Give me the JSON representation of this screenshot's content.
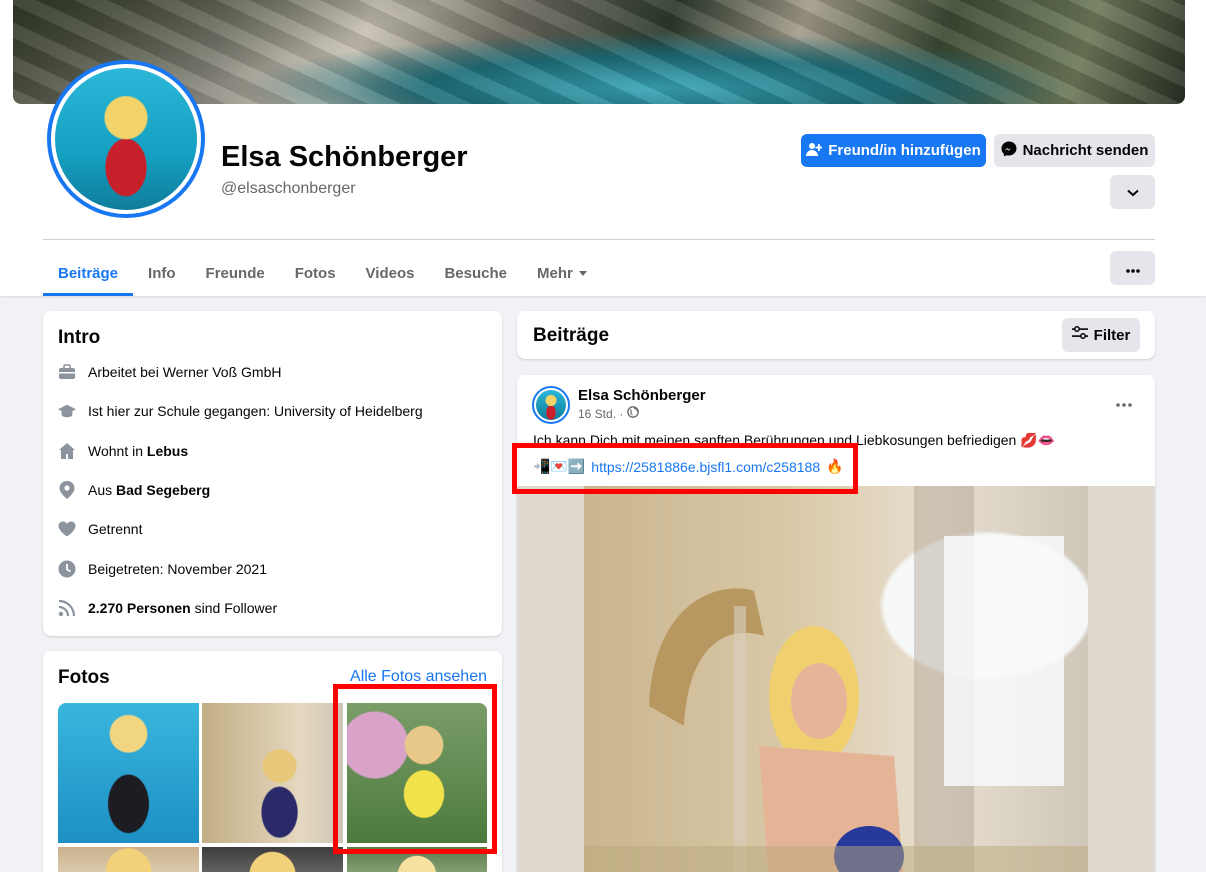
{
  "profile": {
    "name": "Elsa Schönberger",
    "handle": "@elsaschonberger",
    "add_friend_label": "Freund/in hinzufügen",
    "message_label": "Nachricht senden"
  },
  "tabs": [
    "Beiträge",
    "Info",
    "Freunde",
    "Fotos",
    "Videos",
    "Besuche",
    "Mehr"
  ],
  "intro": {
    "title": "Intro",
    "work": "Arbeitet bei Werner Voß GmbH",
    "school": "Ist hier zur Schule gegangen: University of Heidelberg",
    "lives_prefix": "Wohnt in ",
    "lives_city": "Lebus",
    "from_prefix": "Aus ",
    "from_city": "Bad Segeberg",
    "relationship": "Getrennt",
    "joined": "Beigetreten: November 2021",
    "followers_count": "2.270 Personen",
    "followers_suffix": " sind Follower"
  },
  "photos": {
    "title": "Fotos",
    "see_all": "Alle Fotos ansehen"
  },
  "posts": {
    "title": "Beiträge",
    "filter_label": "Filter"
  },
  "post": {
    "author": "Elsa Schönberger",
    "time": "16 Std. ·",
    "text": "Ich kann Dich mit meinen sanften Berührungen und Liebkosungen befriedigen 💋👄",
    "link_prefix_emoji": "📲💌➡️",
    "link": "https://2581886e.bjsfl1.com/c258188",
    "link_suffix_emoji": "🔥"
  },
  "colors": {
    "accent": "#1877f2",
    "highlight": "#ff0000"
  }
}
